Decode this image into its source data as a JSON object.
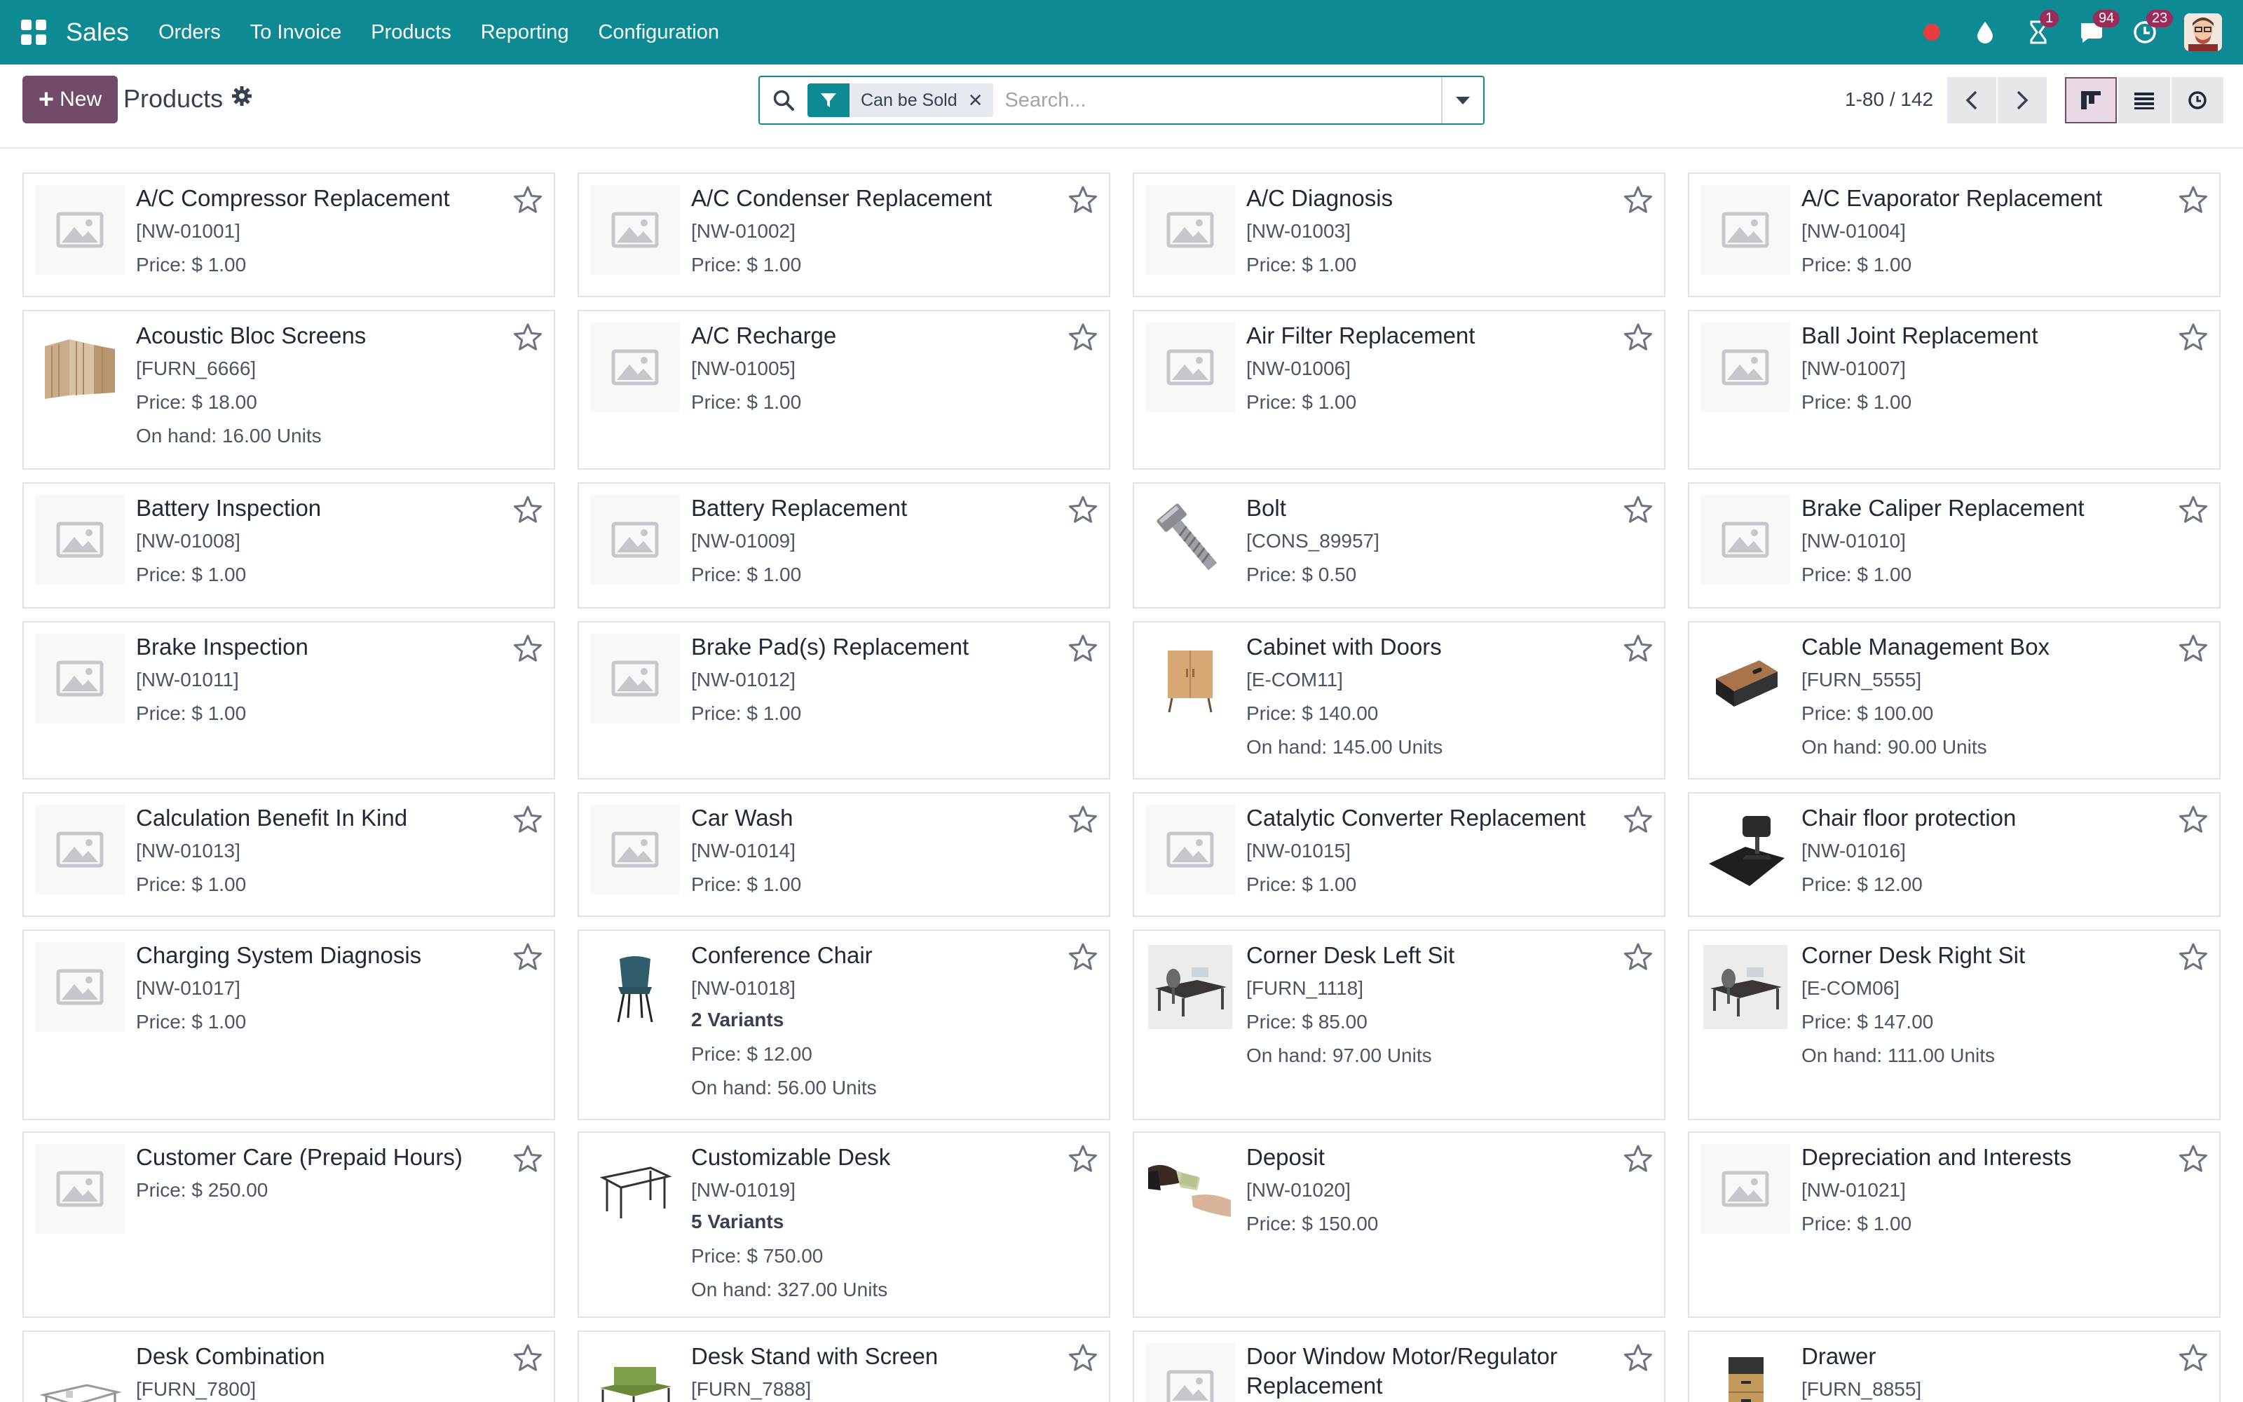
{
  "navbar": {
    "brand": "Sales",
    "menu": [
      "Orders",
      "To Invoice",
      "Products",
      "Reporting",
      "Configuration"
    ],
    "badges": {
      "activity": "1",
      "messages": "94",
      "clock": "23"
    },
    "colors": {
      "bar": "#0e8a94",
      "status_dot": "#e53e3e",
      "badge": "#9b2c5a"
    }
  },
  "control": {
    "new_label": "New",
    "title": "Products",
    "facet_label": "Can be Sold",
    "search_placeholder": "Search...",
    "pager": "1-80 / 142"
  },
  "products": [
    {
      "name": "A/C Compressor Replacement",
      "ref": "[NW-01001]",
      "price": "Price: $ 1.00"
    },
    {
      "name": "A/C Condenser Replacement",
      "ref": "[NW-01002]",
      "price": "Price: $ 1.00"
    },
    {
      "name": "A/C Diagnosis",
      "ref": "[NW-01003]",
      "price": "Price: $ 1.00"
    },
    {
      "name": "A/C Evaporator Replacement",
      "ref": "[NW-01004]",
      "price": "Price: $ 1.00"
    },
    {
      "name": "Acoustic Bloc Screens",
      "ref": "[FURN_6666]",
      "price": "Price: $ 18.00",
      "onhand": "On hand: 16.00 Units",
      "image": "screens"
    },
    {
      "name": "A/C Recharge",
      "ref": "[NW-01005]",
      "price": "Price: $ 1.00"
    },
    {
      "name": "Air Filter Replacement",
      "ref": "[NW-01006]",
      "price": "Price: $ 1.00"
    },
    {
      "name": "Ball Joint Replacement",
      "ref": "[NW-01007]",
      "price": "Price: $ 1.00"
    },
    {
      "name": "Battery Inspection",
      "ref": "[NW-01008]",
      "price": "Price: $ 1.00"
    },
    {
      "name": "Battery Replacement",
      "ref": "[NW-01009]",
      "price": "Price: $ 1.00"
    },
    {
      "name": "Bolt",
      "ref": "[CONS_89957]",
      "price": "Price: $ 0.50",
      "image": "bolt"
    },
    {
      "name": "Brake Caliper Replacement",
      "ref": "[NW-01010]",
      "price": "Price: $ 1.00"
    },
    {
      "name": "Brake Inspection",
      "ref": "[NW-01011]",
      "price": "Price: $ 1.00"
    },
    {
      "name": "Brake Pad(s) Replacement",
      "ref": "[NW-01012]",
      "price": "Price: $ 1.00"
    },
    {
      "name": "Cabinet with Doors",
      "ref": "[E-COM11]",
      "price": "Price: $ 140.00",
      "onhand": "On hand: 145.00 Units",
      "image": "cabinet"
    },
    {
      "name": "Cable Management Box",
      "ref": "[FURN_5555]",
      "price": "Price: $ 100.00",
      "onhand": "On hand: 90.00 Units",
      "image": "cablebox"
    },
    {
      "name": "Calculation Benefit In Kind",
      "ref": "[NW-01013]",
      "price": "Price: $ 1.00"
    },
    {
      "name": "Car Wash",
      "ref": "[NW-01014]",
      "price": "Price: $ 1.00"
    },
    {
      "name": "Catalytic Converter Replacement",
      "ref": "[NW-01015]",
      "price": "Price: $ 1.00"
    },
    {
      "name": "Chair floor protection",
      "ref": "[NW-01016]",
      "price": "Price: $ 12.00",
      "image": "floormat"
    },
    {
      "name": "Charging System Diagnosis",
      "ref": "[NW-01017]",
      "price": "Price: $ 1.00"
    },
    {
      "name": "Conference Chair",
      "ref": "[NW-01018]",
      "variants": "2 Variants",
      "price": "Price: $ 12.00",
      "onhand": "On hand: 56.00 Units",
      "image": "chair"
    },
    {
      "name": "Corner Desk Left Sit",
      "ref": "[FURN_1118]",
      "price": "Price: $ 85.00",
      "onhand": "On hand: 97.00 Units",
      "image": "desk"
    },
    {
      "name": "Corner Desk Right Sit",
      "ref": "[E-COM06]",
      "price": "Price: $ 147.00",
      "onhand": "On hand: 111.00 Units",
      "image": "desk"
    },
    {
      "name": "Customer Care (Prepaid Hours)",
      "price": "Price: $ 250.00"
    },
    {
      "name": "Customizable Desk",
      "ref": "[NW-01019]",
      "variants": "5 Variants",
      "price": "Price: $ 750.00",
      "onhand": "On hand: 327.00 Units",
      "image": "customdesk"
    },
    {
      "name": "Deposit",
      "ref": "[NW-01020]",
      "price": "Price: $ 150.00",
      "image": "deposit"
    },
    {
      "name": "Depreciation and Interests",
      "ref": "[NW-01021]",
      "price": "Price: $ 1.00"
    },
    {
      "name": "Desk Combination",
      "ref": "[FURN_7800]",
      "image": "deskcombo"
    },
    {
      "name": "Desk Stand with Screen",
      "ref": "[FURN_7888]",
      "image": "deskstand"
    },
    {
      "name": "Door Window Motor/Regulator Replacement"
    },
    {
      "name": "Drawer",
      "ref": "[FURN_8855]",
      "image": "drawer"
    }
  ]
}
